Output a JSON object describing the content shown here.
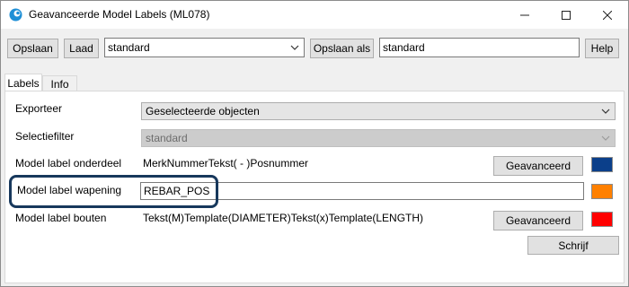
{
  "window": {
    "title": "Geavanceerde Model Labels (ML078)",
    "minimize_glyph": "minimize",
    "maximize_glyph": "maximize",
    "close_glyph": "close"
  },
  "toolbar": {
    "save_label": "Opslaan",
    "load_label": "Laad",
    "preset_value": "standard",
    "save_as_label": "Opslaan als",
    "save_as_value": "standard",
    "help_label": "Help"
  },
  "tabs": [
    {
      "label": "Labels",
      "active": true
    },
    {
      "label": "Info",
      "active": false
    }
  ],
  "form": {
    "export": {
      "label": "Exporteer",
      "value": "Geselecteerde objecten"
    },
    "selection_filter": {
      "label": "Selectiefilter",
      "value": "standard"
    },
    "part_label": {
      "label": "Model label onderdeel",
      "value": "MerkNummerTekst( - )Posnummer",
      "button": "Geavanceerd",
      "color": "#0b3f8a"
    },
    "rebar_label": {
      "label": "Model label wapening",
      "value": "REBAR_POS",
      "color": "#ff8000"
    },
    "bolt_label": {
      "label": "Model label bouten",
      "value": "Tekst(M)Template(DIAMETER)Tekst(x)Template(LENGTH)",
      "button": "Geavanceerd",
      "color": "#ff0000"
    },
    "write_button": "Schrijf"
  },
  "colors": {
    "highlight_border": "#17385c",
    "app_icon": "#1e8fd6"
  },
  "icons": {
    "app": "app-logo-icon",
    "combo": "chevron-down-icon"
  }
}
